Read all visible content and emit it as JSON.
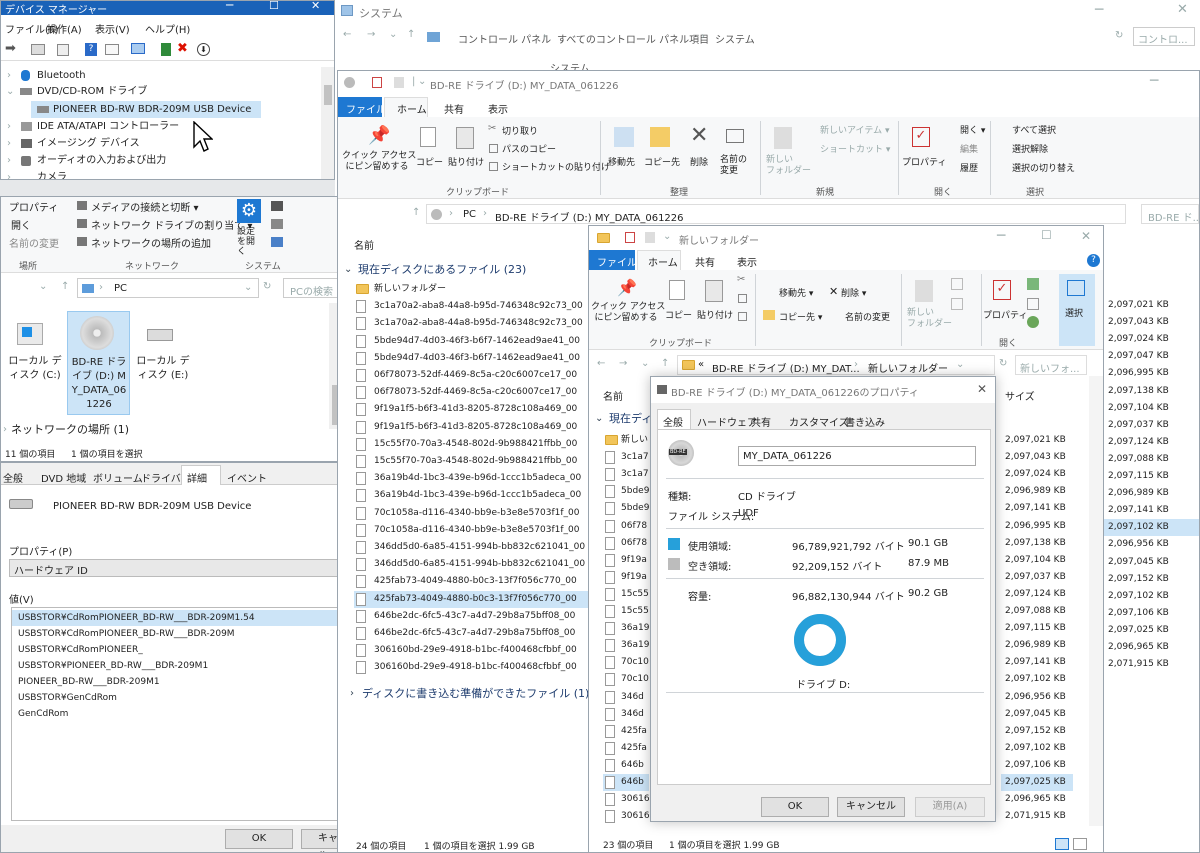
{
  "sys": {
    "title": "システム",
    "crumb": [
      "コントロール パネル",
      "すべてのコントロール パネル項目",
      "システム"
    ],
    "search": "コントロ...",
    "sub": "システム"
  },
  "dm": {
    "title": "デバイス マネージャー",
    "menu": [
      "ファイル(F)",
      "操作(A)",
      "表示(V)",
      "ヘルプ(H)"
    ],
    "tree": [
      "Bluetooth",
      "DVD/CD-ROM ドライブ",
      "PIONEER BD-RW    BDR-209M USB Device",
      "IDE ATA/ATAPI コントローラー",
      "イメージング デバイス",
      "オーディオの入力および出力",
      "カメラ"
    ]
  },
  "pc": {
    "ribbon": {
      "left": [
        "プロパティ",
        "開く",
        "名前の変更"
      ],
      "net": [
        "メディアの接続と切断 ▾",
        "ネットワーク ドライブの割り当て ▾",
        "ネットワークの場所の追加"
      ],
      "settings": "設定を開く",
      "groups": [
        "場所",
        "ネットワーク",
        "システム"
      ]
    },
    "addr": "PC",
    "search": "PCの検索",
    "drives": [
      "ローカル ディスク (C:)",
      "BD-RE ドライブ (D:) MY_DATA_061226",
      "ローカル ディスク (E:)"
    ],
    "network": "ネットワークの場所 (1)",
    "status": [
      "11 個の項目",
      "1 個の項目を選択"
    ]
  },
  "props": {
    "tabs": [
      "全般",
      "DVD 地域",
      "ボリューム",
      "ドライバー",
      "詳細",
      "イベント"
    ],
    "device": "PIONEER BD-RW   BDR-209M USB Device",
    "prop_label": "プロパティ(P)",
    "prop_value": "ハードウェア ID",
    "val_label": "値(V)",
    "values": [
      "USBSTOR¥CdRomPIONEER_BD-RW___BDR-209M1.54",
      "USBSTOR¥CdRomPIONEER_BD-RW___BDR-209M",
      "USBSTOR¥CdRomPIONEER_",
      "USBSTOR¥PIONEER_BD-RW___BDR-209M1",
      "PIONEER_BD-RW___BDR-209M1",
      "USBSTOR¥GenCdRom",
      "GenCdRom"
    ],
    "ok": "OK",
    "cancel": "キャンセル"
  },
  "bd": {
    "title": "BD-RE ドライブ (D:) MY_DATA_061226",
    "tabs": [
      "ファイル",
      "ホーム",
      "共有",
      "表示"
    ],
    "clip": {
      "pin": "クイック アクセス\nにピン留めする",
      "copy": "コピー",
      "paste": "貼り付け",
      "cut": "切り取り",
      "copypath": "パスのコピー",
      "shortcut": "ショートカットの貼り付け"
    },
    "org": {
      "move": "移動先",
      "copyto": "コピー先",
      "del": "削除",
      "rename": "名前の\n変更"
    },
    "newg": {
      "folder": "新しい\nフォルダー",
      "item": "新しいアイテム ▾",
      "shortcut": "ショートカット ▾"
    },
    "openg": {
      "prop": "プロパティ",
      "open": "開く ▾",
      "edit": "編集",
      "history": "履歴"
    },
    "selg": {
      "all": "すべて選択",
      "none": "選択解除",
      "invert": "選択の切り替え"
    },
    "groups": [
      "クリップボード",
      "整理",
      "新規",
      "開く",
      "選択"
    ],
    "addr": [
      "PC",
      "BD-RE ドライブ (D:) MY_DATA_061226"
    ],
    "search": "BD-RE ド...",
    "col": "名前",
    "group1": "現在ディスクにあるファイル (23)",
    "group2": "ディスクに書き込む準備ができたファイル (1)",
    "files": [
      "新しいフォルダー",
      "3c1a70a2-aba8-44a8-b95d-746348c92c73_00",
      "3c1a70a2-aba8-44a8-b95d-746348c92c73_00",
      "5bde94d7-4d03-46f3-b6f7-1462ead9ae41_00",
      "5bde94d7-4d03-46f3-b6f7-1462ead9ae41_00",
      "06f78073-52df-4469-8c5a-c20c6007ce17_00",
      "06f78073-52df-4469-8c5a-c20c6007ce17_00",
      "9f19a1f5-b6f3-41d3-8205-8728c108a469_00",
      "9f19a1f5-b6f3-41d3-8205-8728c108a469_00",
      "15c55f70-70a3-4548-802d-9b988421ffbb_00",
      "15c55f70-70a3-4548-802d-9b988421ffbb_00",
      "36a19b4d-1bc3-439e-b96d-1ccc1b5adeca_00",
      "36a19b4d-1bc3-439e-b96d-1ccc1b5adeca_00",
      "70c1058a-d116-4340-bb9e-b3e8e5703f1f_00",
      "70c1058a-d116-4340-bb9e-b3e8e5703f1f_00",
      "346dd5d0-6a85-4151-994b-bb832c621041_00",
      "346dd5d0-6a85-4151-994b-bb832c621041_00",
      "425fab73-4049-4880-b0c3-13f7f056c770_00",
      "425fab73-4049-4880-b0c3-13f7f056c770_00",
      "646be2dc-6fc5-43c7-a4d7-29b8a75bff08_00",
      "646be2dc-6fc5-43c7-a4d7-29b8a75bff08_00",
      "306160bd-29e9-4918-b1bc-f400468cfbbf_00",
      "306160bd-29e9-4918-b1bc-f400468cfbbf_00"
    ],
    "sizes": [
      "2,097,021 KB",
      "2,097,043 KB",
      "2,097,024 KB",
      "2,097,047 KB",
      "2,096,995 KB",
      "2,097,138 KB",
      "2,097,104 KB",
      "2,097,037 KB",
      "2,097,124 KB",
      "2,097,088 KB",
      "2,097,115 KB",
      "2,096,989 KB",
      "2,097,141 KB",
      "2,097,102 KB",
      "2,096,956 KB",
      "2,097,045 KB",
      "2,097,152 KB",
      "2,097,102 KB",
      "2,097,106 KB",
      "2,097,025 KB",
      "2,096,965 KB",
      "2,071,915 KB"
    ],
    "status": [
      "24 個の項目",
      "1 個の項目を選択  1.99 GB"
    ]
  },
  "nf": {
    "title": "新しいフォルダー",
    "tabs": [
      "ファイル",
      "ホーム",
      "共有",
      "表示"
    ],
    "addr": [
      "«",
      "BD-RE ドライブ (D:) MY_DAT...",
      "新しいフォルダー"
    ],
    "search": "新しいフォ...",
    "clip": {
      "pin": "クイック アクセス\nにピン留めする",
      "copy": "コピー",
      "paste": "貼り付け"
    },
    "org": {
      "move": "移動先 ▾",
      "copyto": "コピー先 ▾",
      "del": "削除 ▾",
      "rename": "名前の変更"
    },
    "newfolder": "新しい\nフォルダー",
    "prop": "プロパティ",
    "select": "選択",
    "groups": [
      "クリップボード",
      "整理",
      "新規",
      "開く"
    ],
    "col": "名前",
    "col2": "サイズ",
    "group1": "現在ディ",
    "files": [
      "新しい",
      "3c1a7",
      "3c1a7",
      "5bde9",
      "5bde9",
      "06f78",
      "06f78",
      "9f19a",
      "9f19a",
      "15c55",
      "15c55",
      "36a19",
      "36a19",
      "70c10",
      "70c10",
      "346d",
      "346d",
      "425fa",
      "425fa",
      "646b",
      "646b",
      "30616",
      "30616"
    ],
    "sizes": [
      "2,097,021 KB",
      "2,097,043 KB",
      "2,097,024 KB",
      "2,096,989 KB",
      "2,097,141 KB",
      "2,096,995 KB",
      "2,097,138 KB",
      "2,097,104 KB",
      "2,097,037 KB",
      "2,097,124 KB",
      "2,097,088 KB",
      "2,097,115 KB",
      "2,096,989 KB",
      "2,097,141 KB",
      "2,097,102 KB",
      "2,096,956 KB",
      "2,097,045 KB",
      "2,097,152 KB",
      "2,097,102 KB",
      "2,097,106 KB",
      "2,097,025 KB",
      "2,096,965 KB",
      "2,071,915 KB"
    ],
    "status": [
      "23 個の項目",
      "1 個の項目を選択  1.99 GB"
    ]
  },
  "dlg": {
    "title": "BD-RE ドライブ (D:) MY_DATA_061226のプロパティ",
    "tabs": [
      "全般",
      "ハードウェア",
      "共有",
      "カスタマイズ",
      "書き込み"
    ],
    "icon_label": "BD-RE",
    "name": "MY_DATA_061226",
    "type_k": "種類:",
    "type_v": "CD ドライブ",
    "fs_k": "ファイル システム:",
    "fs_v": "UDF",
    "used_k": "使用領域:",
    "used_b": "96,789,921,792 バイト",
    "used_g": "90.1 GB",
    "free_k": "空き領域:",
    "free_b": "92,209,152 バイト",
    "free_g": "87.9 MB",
    "cap_k": "容量:",
    "cap_b": "96,882,130,944 バイト",
    "cap_g": "90.2 GB",
    "drive": "ドライブ D:",
    "ok": "OK",
    "cancel": "キャンセル",
    "apply": "適用(A)",
    "used_fraction": 0.999
  },
  "colors": {
    "accent": "#1e78d2",
    "used": "#26a0da",
    "free": "#bcbcbc"
  }
}
